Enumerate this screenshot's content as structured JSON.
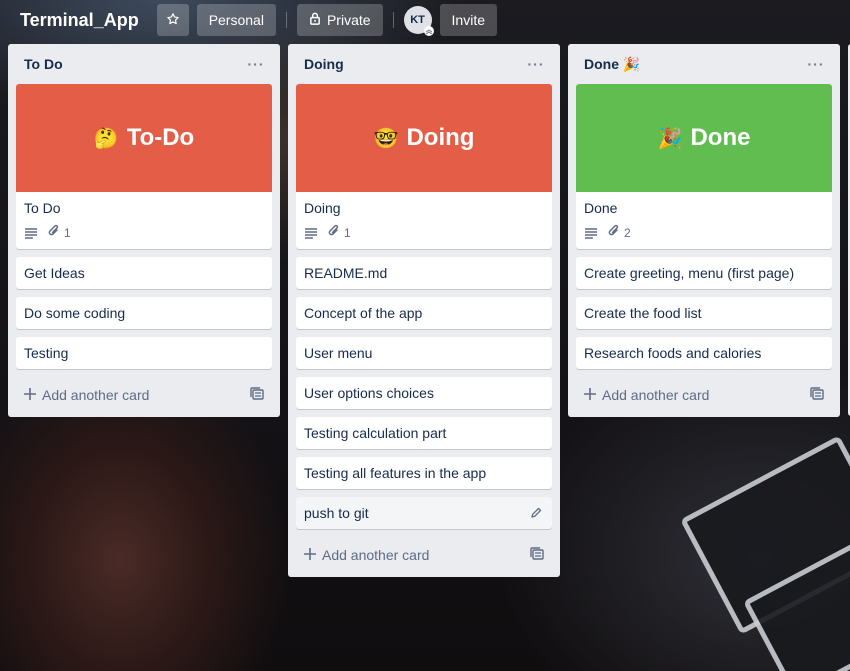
{
  "header": {
    "title": "Terminal_App",
    "star_icon": "star-icon",
    "workspace_label": "Personal",
    "visibility_label": "Private",
    "visibility_icon": "lock-icon",
    "avatar_initials": "KT",
    "invite_label": "Invite"
  },
  "lists": [
    {
      "title": "To Do",
      "title_emoji": "",
      "cover_card": {
        "cover_color": "#e35d47",
        "cover_emoji": "🤔",
        "cover_text": "To-Do",
        "title": "To Do",
        "attachments": "1"
      },
      "cards": [
        "Get Ideas",
        "Do some coding",
        "Testing"
      ],
      "add_label": "Add another card"
    },
    {
      "title": "Doing",
      "title_emoji": "",
      "cover_card": {
        "cover_color": "#e35d47",
        "cover_emoji": "🤓",
        "cover_text": "Doing",
        "title": "Doing",
        "attachments": "1"
      },
      "cards": [
        "README.md",
        "Concept of the app",
        "User menu",
        "User options choices",
        "Testing calculation part",
        "Testing all features in the app",
        "push to git"
      ],
      "add_label": "Add another card"
    },
    {
      "title": "Done",
      "title_emoji": "🎉",
      "cover_card": {
        "cover_color": "#61bd4f",
        "cover_emoji": "🎉",
        "cover_text": "Done",
        "title": "Done",
        "attachments": "2"
      },
      "cards": [
        "Create greeting, menu (first page)",
        "Create the food list",
        "Research foods and calories"
      ],
      "add_label": "Add another card"
    }
  ],
  "colors": {
    "list_bg": "#ebecf0",
    "cover_red": "#e35d47",
    "cover_green": "#61bd4f"
  }
}
